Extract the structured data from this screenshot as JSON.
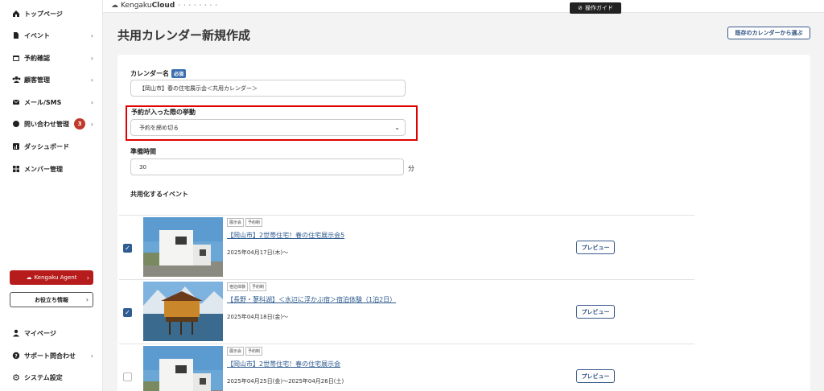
{
  "sidebar": {
    "items": [
      {
        "label": "トップページ",
        "icon": "home-icon",
        "chevron": false
      },
      {
        "label": "イベント",
        "icon": "document-icon",
        "chevron": true
      },
      {
        "label": "予約確認",
        "icon": "calendar-icon",
        "chevron": true
      },
      {
        "label": "顧客管理",
        "icon": "people-icon",
        "chevron": true
      },
      {
        "label": "メール/SMS",
        "icon": "mail-icon",
        "chevron": true
      },
      {
        "label": "問い合わせ管理",
        "icon": "chat-icon",
        "chevron": true,
        "badge": "3"
      },
      {
        "label": "ダッシュボード",
        "icon": "chart-icon",
        "chevron": false
      },
      {
        "label": "メンバー管理",
        "icon": "grid-icon",
        "chevron": false
      }
    ],
    "agent_label": "Kengaku Agent",
    "useful_label": "お役立ち情報",
    "bottom_items": [
      {
        "label": "マイページ",
        "icon": "user-icon",
        "chevron": false
      },
      {
        "label": "サポート問合わせ",
        "icon": "help-icon",
        "chevron": true
      },
      {
        "label": "システム設定",
        "icon": "gear-icon",
        "chevron": false
      }
    ]
  },
  "header": {
    "logo_prefix": "Kengaku",
    "logo_bold": "Cloud",
    "logo_sub": "• • • • • • • •",
    "guide_label": "操作ガイド"
  },
  "page": {
    "title": "共用カレンダー新規作成",
    "existing_button": "既存のカレンダーから選ぶ"
  },
  "form": {
    "name_label": "カレンダー名",
    "required_badge": "必須",
    "name_value": "【岡山市】春の住宅展示会＜共用カレンダー＞",
    "behavior_label": "予約が入った際の挙動",
    "behavior_value": "予約を締め切る",
    "prep_label": "準備時間",
    "prep_value": "30",
    "prep_unit": "分",
    "events_label": "共用化するイベント"
  },
  "events": [
    {
      "tags": [
        "展示会",
        "予約制"
      ],
      "title": "【岡山市】2世帯住宅！春の住宅展示会5",
      "date": "2025年04月17日(木)〜",
      "checked": true,
      "preview": "プレビュー",
      "image": "white-house"
    },
    {
      "tags": [
        "宿泊体験",
        "予約制"
      ],
      "title": "【長野・蓼科湖】＜水辺に浮かぶ宿＞宿泊体験（1泊2日）",
      "date": "2025年04月18日(金)〜",
      "checked": true,
      "preview": "プレビュー",
      "image": "lake-cabin"
    },
    {
      "tags": [
        "展示会",
        "予約制"
      ],
      "title": "【岡山市】2世帯住宅！春の住宅展示会",
      "date": "2025年04月25日(金)〜2025年04月26日(土)",
      "checked": false,
      "preview": "プレビュー",
      "image": "white-house"
    }
  ],
  "colors": {
    "accent": "#2f5d92",
    "agent": "#b71c1c",
    "highlight": "#e00000"
  }
}
